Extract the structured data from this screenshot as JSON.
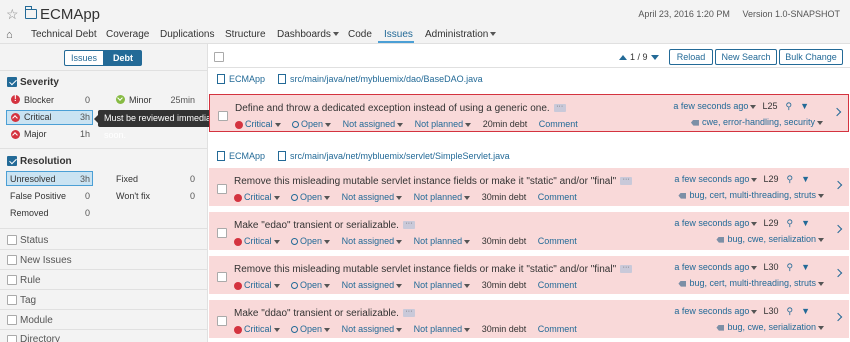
{
  "header": {
    "app_title": "ECMApp",
    "date": "April 23, 2016 1:20 PM",
    "version": "Version 1.0-SNAPSHOT"
  },
  "nav": {
    "technical_debt": "Technical Debt",
    "coverage": "Coverage",
    "duplications": "Duplications",
    "structure": "Structure",
    "dashboards": "Dashboards",
    "code": "Code",
    "issues": "Issues",
    "administration": "Administration"
  },
  "mode": {
    "issues": "Issues",
    "debt": "Debt"
  },
  "facets": {
    "severity": {
      "title": "Severity",
      "items": [
        {
          "label": "Blocker",
          "value": "0"
        },
        {
          "label": "Minor",
          "value": "25min"
        },
        {
          "label": "Critical",
          "value": "3h"
        },
        {
          "label": "Major",
          "value": "1h"
        }
      ]
    },
    "tooltip": "Must be reviewed immediately and fixed soon.",
    "resolution": {
      "title": "Resolution",
      "items": [
        {
          "label": "Unresolved",
          "value": "3h"
        },
        {
          "label": "Fixed",
          "value": "0"
        },
        {
          "label": "False Positive",
          "value": "0"
        },
        {
          "label": "Won't fix",
          "value": "0"
        },
        {
          "label": "Removed",
          "value": "0"
        }
      ]
    },
    "closed": [
      "Status",
      "New Issues",
      "Rule",
      "Tag",
      "Module",
      "Directory"
    ]
  },
  "toolbar": {
    "paging": "1 / 9",
    "reload": "Reload",
    "new_search": "New Search",
    "bulk_change": "Bulk Change"
  },
  "groups": [
    {
      "component": "ECMApp",
      "path": "src/main/java/net/mybluemix/dao/BaseDAO.java"
    },
    {
      "component": "ECMApp",
      "path": "src/main/java/net/mybluemix/servlet/SimpleServlet.java"
    }
  ],
  "issues": [
    {
      "message": "Define and throw a dedicated exception instead of using a generic one.",
      "severity": "Critical",
      "status": "Open",
      "assignee": "Not assigned",
      "plan": "Not planned",
      "debt": "20min debt",
      "comment": "Comment",
      "time": "a few seconds ago",
      "line": "L25",
      "tags": "cwe, error-handling, security"
    },
    {
      "message": "Remove this misleading mutable servlet instance fields or make it \"static\" and/or \"final\"",
      "severity": "Critical",
      "status": "Open",
      "assignee": "Not assigned",
      "plan": "Not planned",
      "debt": "30min debt",
      "comment": "Comment",
      "time": "a few seconds ago",
      "line": "L29",
      "tags": "bug, cert, multi-threading, struts"
    },
    {
      "message": "Make \"edao\" transient or serializable.",
      "severity": "Critical",
      "status": "Open",
      "assignee": "Not assigned",
      "plan": "Not planned",
      "debt": "30min debt",
      "comment": "Comment",
      "time": "a few seconds ago",
      "line": "L29",
      "tags": "bug, cwe, serialization"
    },
    {
      "message": "Remove this misleading mutable servlet instance fields or make it \"static\" and/or \"final\"",
      "severity": "Critical",
      "status": "Open",
      "assignee": "Not assigned",
      "plan": "Not planned",
      "debt": "30min debt",
      "comment": "Comment",
      "time": "a few seconds ago",
      "line": "L30",
      "tags": "bug, cert, multi-threading, struts"
    },
    {
      "message": "Make \"ddao\" transient or serializable.",
      "severity": "Critical",
      "status": "Open",
      "assignee": "Not assigned",
      "plan": "Not planned",
      "debt": "30min debt",
      "comment": "Comment",
      "time": "a few seconds ago",
      "line": "L30",
      "tags": "bug, cwe, serialization"
    }
  ]
}
